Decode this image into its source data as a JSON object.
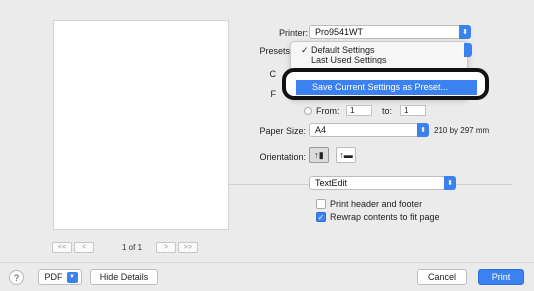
{
  "printer": {
    "label": "Printer:",
    "value": "Pro9541WT"
  },
  "presets": {
    "label": "Presets",
    "menu": {
      "items": [
        "Default Settings",
        "Last Used Settings"
      ],
      "checked_mark": "✓",
      "highlighted": "Save Current Settings as Preset..."
    }
  },
  "partial_labels": {
    "copies": "C",
    "pages": "F"
  },
  "page_range": {
    "from_label": "From:",
    "from_value": "1",
    "to_label": "to:",
    "to_value": "1"
  },
  "paper_size": {
    "label": "Paper Size:",
    "value": "A4",
    "dimensions": "210 by 297 mm"
  },
  "orientation": {
    "label": "Orientation:",
    "selected": "portrait"
  },
  "app_section": {
    "value": "TextEdit"
  },
  "options": [
    {
      "label": "Print header and footer",
      "checked": false
    },
    {
      "label": "Rewrap contents to fit page",
      "checked": true
    }
  ],
  "pager": {
    "first": "<<",
    "prev": "<",
    "count": "1 of 1",
    "next": ">",
    "last": ">>"
  },
  "footer": {
    "help": "?",
    "pdf": "PDF",
    "hide_details": "Hide Details",
    "cancel": "Cancel",
    "print": "Print"
  },
  "colors": {
    "accent": "#3b82f0",
    "background": "#ebebeb"
  }
}
